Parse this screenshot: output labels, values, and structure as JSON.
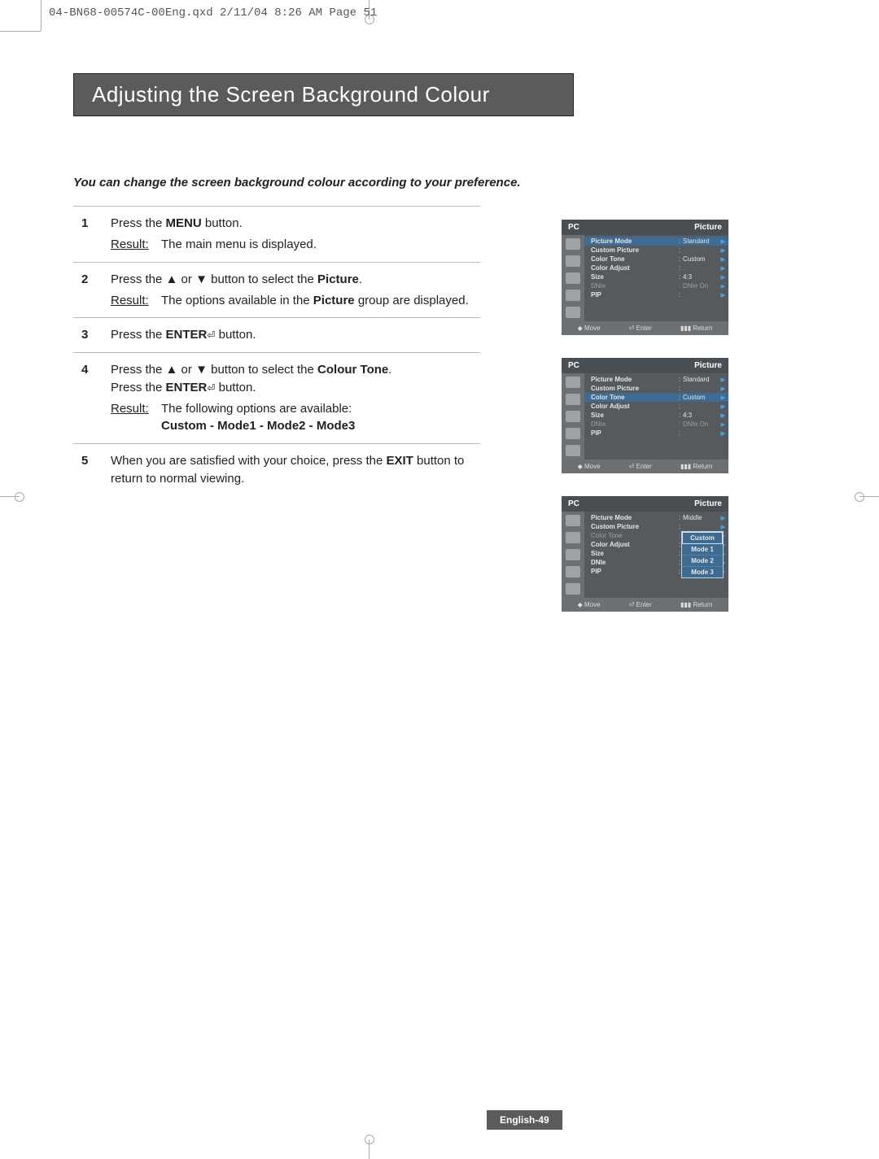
{
  "header": {
    "file_info": "04-BN68-00574C-00Eng.qxd  2/11/04 8:26 AM  Page 51"
  },
  "title": "Adjusting the Screen Background Colour",
  "intro": "You can change the screen background colour according to your preference.",
  "steps": [
    {
      "num": "1",
      "lines": [
        {
          "t": "plain",
          "pre": "Press the ",
          "b": "MENU",
          "post": " button."
        }
      ],
      "result": "The main menu is displayed."
    },
    {
      "num": "2",
      "lines": [
        {
          "t": "arrows",
          "pre": "Press the ",
          "mid": " button to select the ",
          "b": "Picture",
          "post": "."
        }
      ],
      "result_rich": {
        "pre": "The options available in the ",
        "b": "Picture",
        "post": " group are displayed."
      }
    },
    {
      "num": "3",
      "lines": [
        {
          "t": "enter",
          "pre": "Press the ",
          "b": "ENTER",
          "post": " button."
        }
      ]
    },
    {
      "num": "4",
      "lines": [
        {
          "t": "arrows",
          "pre": "Press the ",
          "mid": " button to select the ",
          "b": "Colour Tone",
          "post": "."
        },
        {
          "t": "enter",
          "pre": "Press the ",
          "b": "ENTER",
          "post": " button."
        }
      ],
      "result": "The following options are available:",
      "result_bold": "Custom - Mode1 - Mode2 - Mode3"
    },
    {
      "num": "5",
      "lines": [
        {
          "t": "exit",
          "pre": "When you are satisfied with your choice, press the ",
          "b": "EXIT",
          "post": " button to return to normal viewing."
        }
      ]
    }
  ],
  "result_label": "Result",
  "osd_common": {
    "pc": "PC",
    "picture": "Picture",
    "move": "Move",
    "enter": "Enter",
    "ret": "Return"
  },
  "osd1": {
    "rows": [
      {
        "k": "Picture Mode",
        "v": "Standard",
        "hl": true
      },
      {
        "k": "Custom Picture",
        "v": ""
      },
      {
        "k": "Color Tone",
        "v": "Custom"
      },
      {
        "k": "Color Adjust",
        "v": ""
      },
      {
        "k": "Size",
        "v": "4:3"
      },
      {
        "k": "DNIe",
        "v": "DNIe On",
        "dim": true
      },
      {
        "k": "PIP",
        "v": ""
      }
    ]
  },
  "osd2": {
    "rows": [
      {
        "k": "Picture Mode",
        "v": "Standard"
      },
      {
        "k": "Custom Picture",
        "v": ""
      },
      {
        "k": "Color Tone",
        "v": "Custom",
        "hl": true
      },
      {
        "k": "Color Adjust",
        "v": ""
      },
      {
        "k": "Size",
        "v": "4:3"
      },
      {
        "k": "DNIe",
        "v": "DNIe On",
        "dim": true
      },
      {
        "k": "PIP",
        "v": ""
      }
    ]
  },
  "osd3": {
    "rows": [
      {
        "k": "Picture Mode",
        "v": "Middle"
      },
      {
        "k": "Custom Picture",
        "v": ""
      },
      {
        "k": "Color Tone",
        "v": "",
        "dim": true
      },
      {
        "k": "Color Adjust",
        "v": ""
      },
      {
        "k": "Size",
        "v": ""
      },
      {
        "k": "DNIe",
        "v": ""
      },
      {
        "k": "PIP",
        "v": ""
      }
    ],
    "dropdown": [
      "Custom",
      "Mode 1",
      "Mode 2",
      "Mode 3"
    ]
  },
  "page_number": "English-49"
}
